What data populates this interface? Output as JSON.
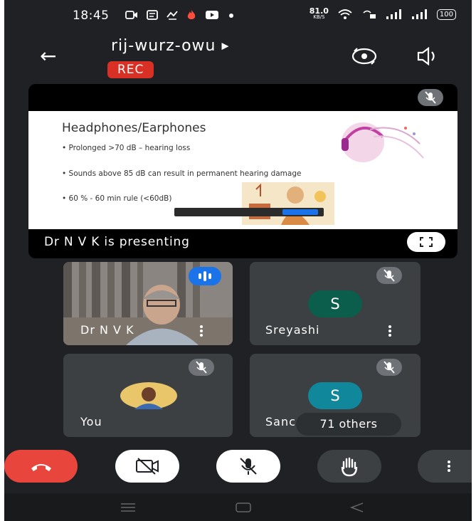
{
  "status_bar": {
    "time": "18:45",
    "net_speed_value": "81.0",
    "net_speed_unit": "KB/S",
    "battery": "100"
  },
  "meeting": {
    "title": "rij-wurz-owu",
    "rec_label": "REC"
  },
  "presentation": {
    "caption": "Dr N V K is presenting",
    "slide": {
      "heading": "Headphones/Earphones",
      "bullets": [
        "• Prolonged >70 dB – hearing loss",
        "• Sounds above 85 dB can result in permanent hearing damage",
        "• 60 % - 60 min rule (<60dB)"
      ]
    }
  },
  "participants": [
    {
      "name": "Dr N V K",
      "speaking": true
    },
    {
      "name": "Sreyashi",
      "avatar_letter": "S",
      "muted": true
    },
    {
      "name": "You",
      "muted": true
    },
    {
      "name": "Sanc",
      "avatar_letter": "S",
      "muted": true
    }
  ],
  "others_label": "71 others",
  "controls": [
    "end-call",
    "camera-off",
    "mic-off",
    "raise-hand",
    "more-options"
  ],
  "colors": {
    "background": "#1f2124",
    "tile": "#3c4043",
    "rec": "#d93025",
    "end_call": "#e8453c",
    "avatar_green": "#0b5e4c",
    "avatar_teal": "#10879a",
    "speaking_blue": "#1a73e8"
  }
}
